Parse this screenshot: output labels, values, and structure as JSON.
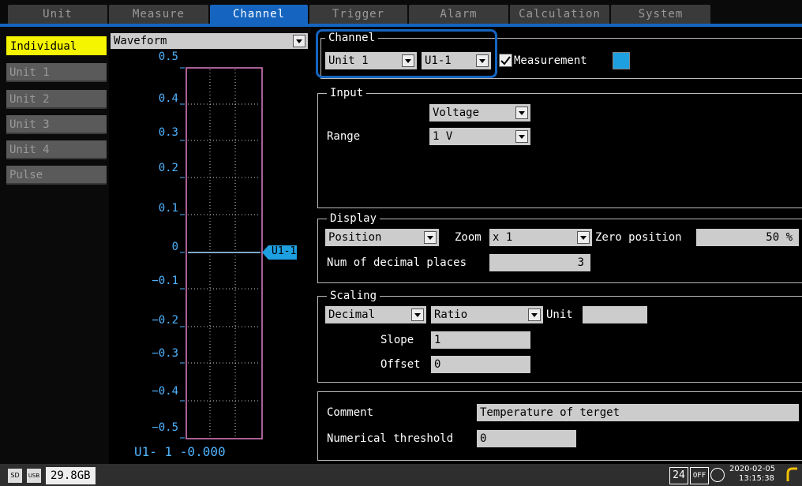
{
  "tabs": [
    "Unit",
    "Measure",
    "Channel",
    "Trigger",
    "Alarm",
    "Calculation",
    "System"
  ],
  "sidebar": {
    "items": [
      "Individual",
      "Unit 1",
      "Unit 2",
      "Unit 3",
      "Unit 4",
      "Pulse"
    ]
  },
  "waveform": {
    "selector": "Waveform",
    "ylabels": [
      "0.5",
      "0.4",
      "0.3",
      "0.2",
      "0.1",
      "0",
      "−0.1",
      "−0.2",
      "−0.3",
      "−0.4",
      "−0.5"
    ],
    "marker": "U1-1",
    "readout": "U1- 1 -0.000"
  },
  "channel": {
    "title": "Channel",
    "unit": "Unit 1",
    "ch": "U1-1",
    "measurement_label": "Measurement",
    "measurement_checked": true,
    "color": "#1e9fe0"
  },
  "input": {
    "title": "Input",
    "type": "Voltage",
    "range_label": "Range",
    "range": "1 V"
  },
  "display": {
    "title": "Display",
    "position": "Position",
    "zoom_label": "Zoom",
    "zoom": "x 1",
    "zero_label": "Zero position",
    "zero": "50 %",
    "decimal_label": "Num of decimal places",
    "decimal": "3"
  },
  "scaling": {
    "title": "Scaling",
    "mode": "Decimal",
    "type": "Ratio",
    "unit_label": "Unit",
    "unit": "",
    "slope_label": "Slope",
    "slope": "1",
    "offset_label": "Offset",
    "offset": "0"
  },
  "comment": {
    "label": "Comment",
    "value": "Temperature of terget",
    "threshold_label": "Numerical threshold",
    "threshold": "0"
  },
  "status": {
    "storage": "29.8GB",
    "sd": "SD",
    "usb": "USB",
    "badge24": "24",
    "off": "OFF",
    "clock": "2020-02-05",
    "time": "13:15:38"
  }
}
